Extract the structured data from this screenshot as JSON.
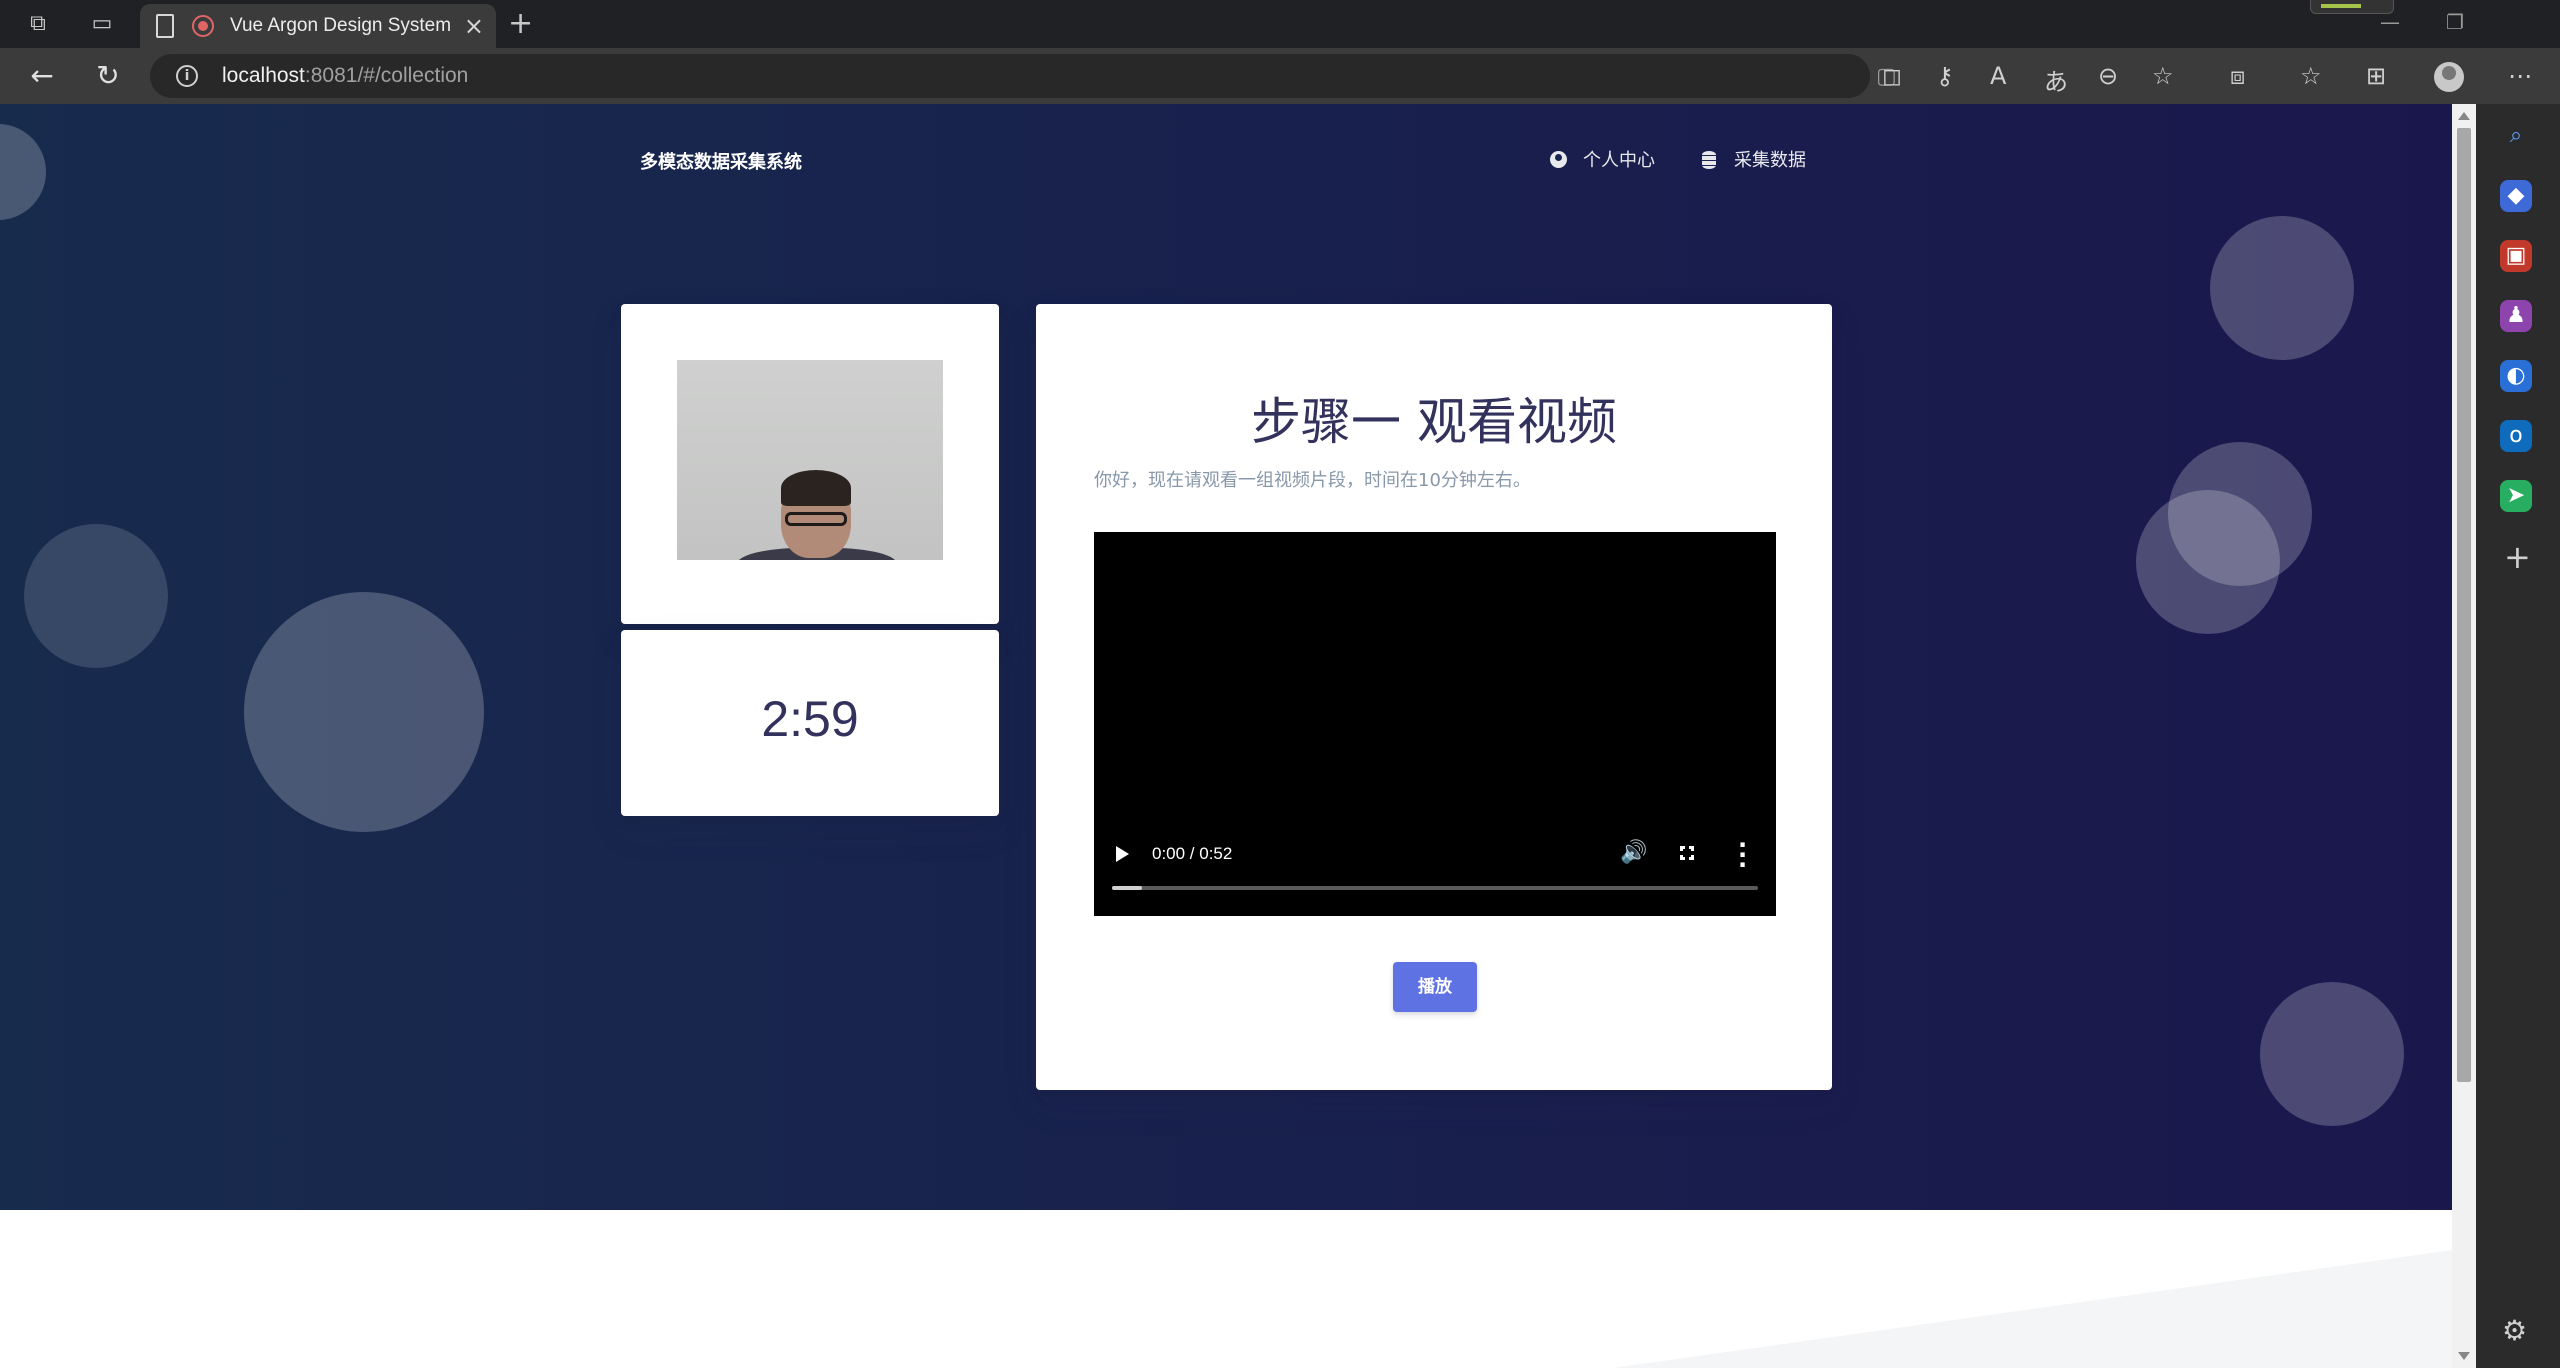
{
  "browser": {
    "tab_title": "Vue Argon Design System",
    "url_host": "localhost",
    "url_rest": ":8081/#/collection"
  },
  "app": {
    "brand": "多模态数据采集系统",
    "nav": {
      "profile": "个人中心",
      "collect": "采集数据"
    }
  },
  "webcam": {
    "timer": "2:59"
  },
  "step": {
    "title": "步骤一 观看视频",
    "description": "你好，现在请观看一组视频片段，时间在10分钟左右。",
    "video_time": "0:00 / 0:52",
    "play_label": "播放",
    "video_progress_fraction": 0.05
  },
  "colors": {
    "hero_start": "#172b4d",
    "hero_end": "#1a174d",
    "primary": "#5e72e4",
    "heading": "#32325d"
  },
  "icons": [
    "workspaces-icon",
    "tab-actions-icon",
    "document-icon",
    "recording-icon",
    "close-icon",
    "plus-icon",
    "back-icon",
    "reload-icon",
    "info-icon",
    "user-circle-icon",
    "database-icon",
    "play-icon",
    "volume-icon",
    "fullscreen-icon",
    "more-icon",
    "search-icon",
    "settings-icon"
  ]
}
